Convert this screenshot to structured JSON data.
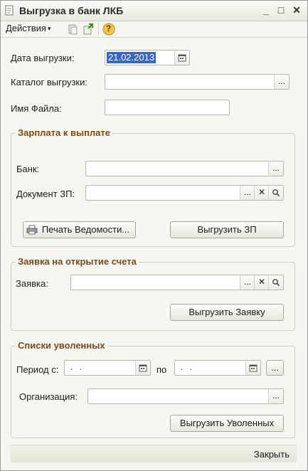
{
  "window": {
    "title": "Выгрузка в банк ЛКБ",
    "minimize": "_",
    "maximize": "□",
    "close": "✕"
  },
  "toolbar": {
    "actions_label": "Действия",
    "actions_arrow": "▾",
    "help_glyph": "?"
  },
  "form": {
    "export_date_label": "Дата выгрузки:",
    "export_date_value": "21.02.2013",
    "catalog_label": "Каталог выгрузки:",
    "catalog_value": "",
    "filename_label": "Имя Файла:",
    "filename_value": ""
  },
  "salary_group": {
    "title": "Зарплата к выплате",
    "bank_label": "Банк:",
    "bank_value": "",
    "doc_label": "Документ ЗП:",
    "doc_value": "",
    "print_button": "Печать Ведомости...",
    "export_button": "Выгрузить ЗП"
  },
  "account_group": {
    "title": "Заявка на открытие счета",
    "request_label": "Заявка:",
    "request_value": "",
    "export_button": "Выгрузить Заявку"
  },
  "dismissed_group": {
    "title": "Списки уволенных",
    "period_from_label": "Период с:",
    "period_from_value": ". .",
    "period_to_label": "по",
    "period_to_value": ". .",
    "org_label": "Организация:",
    "org_value": "",
    "export_button": "Выгрузить Уволенных"
  },
  "glyphs": {
    "ellipsis": "...",
    "clear": "✕"
  },
  "footer": {
    "close_label": "Закрыть"
  }
}
